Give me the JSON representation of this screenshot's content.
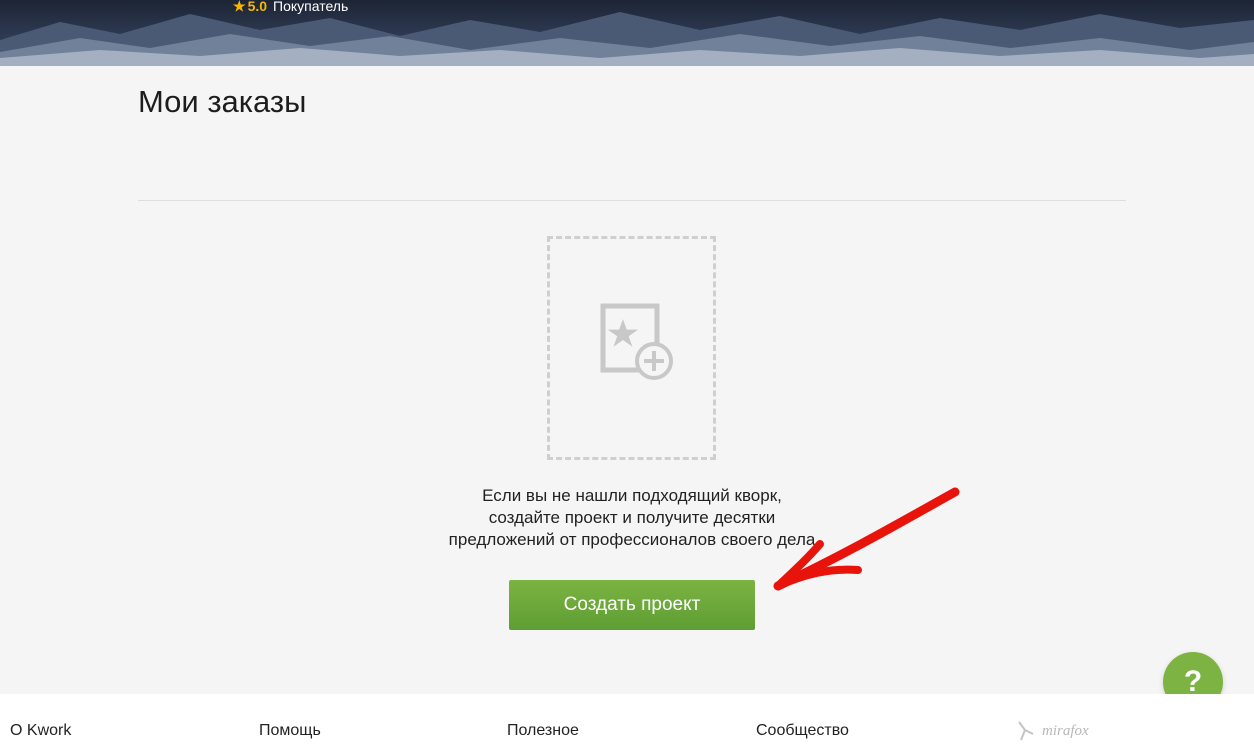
{
  "header": {
    "rating": "5.0",
    "role": "Покупатель",
    "star_icon": "star-icon"
  },
  "main": {
    "title": "Мои заказы",
    "empty_state": {
      "icon": "add-kwork-icon",
      "lines": [
        "Если вы не нашли подходящий кворк,",
        "создайте проект и получите десятки",
        "предложений от профессионалов своего дела"
      ]
    },
    "create_button": "Создать проект"
  },
  "help": {
    "label": "?"
  },
  "footer": {
    "links": [
      "О Kwork",
      "Помощь",
      "Полезное",
      "Сообщество"
    ],
    "brand": "mirafox"
  },
  "colors": {
    "accent_green": "#7cb342",
    "rating_gold": "#f5b800",
    "annotation_red": "#e8140c"
  }
}
